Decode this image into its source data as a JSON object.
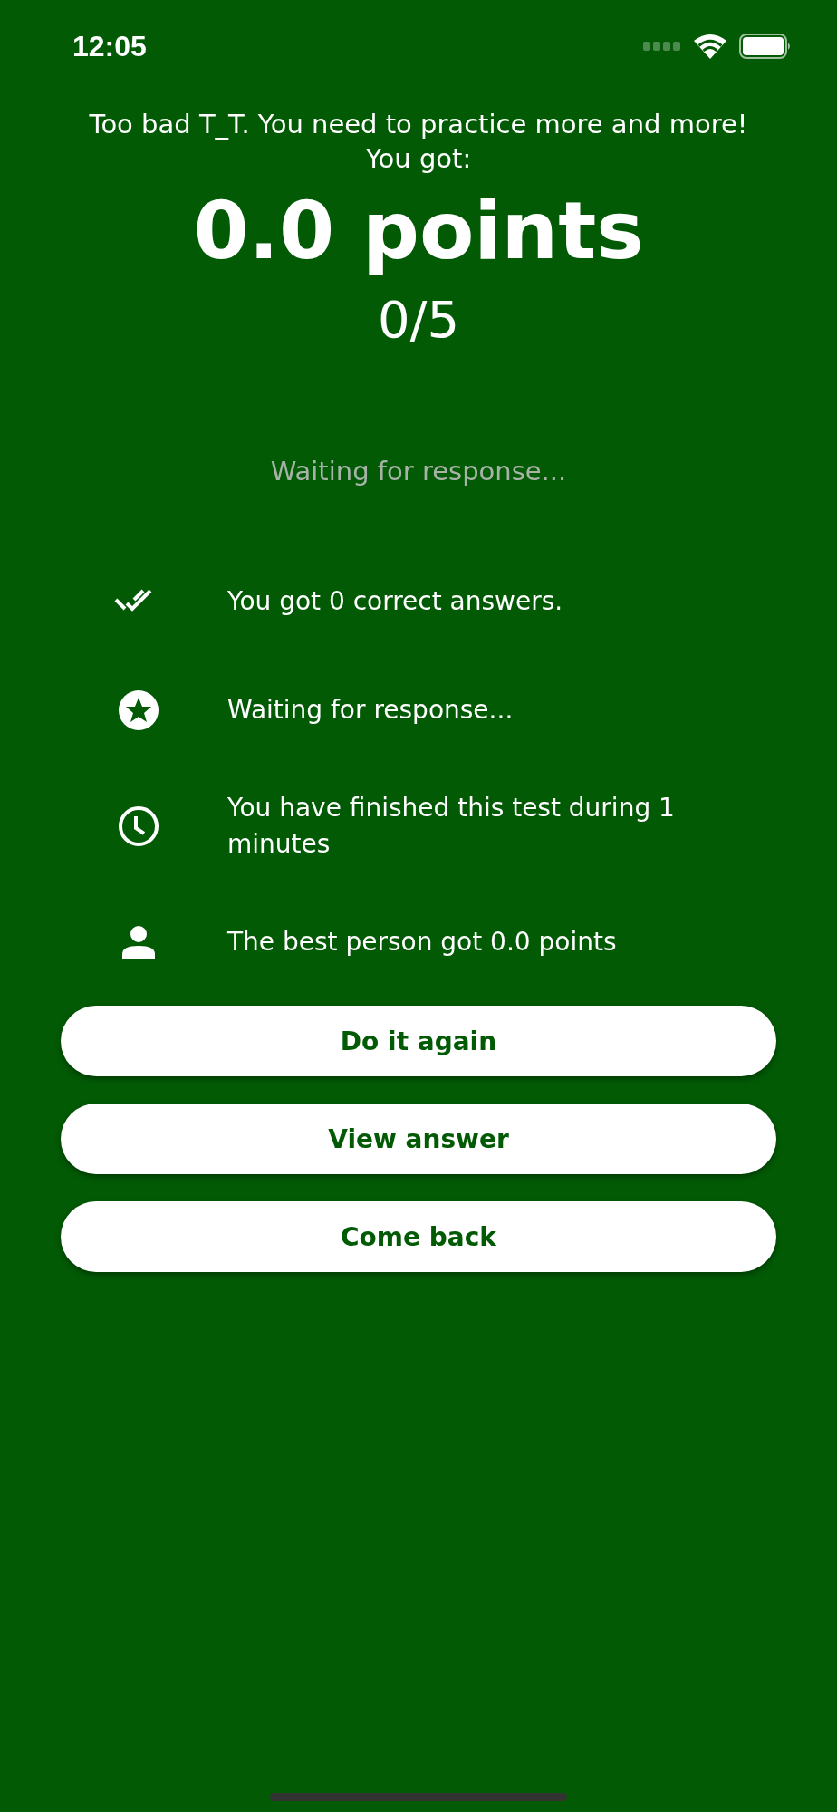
{
  "status_bar": {
    "time": "12:05"
  },
  "message": "Too bad T_T. You need to practice more and more! You got:",
  "score": "0.0 points",
  "fraction": "0/5",
  "rank_status": "Waiting for response...",
  "stats": [
    {
      "text": "You got 0 correct answers."
    },
    {
      "text": "Waiting for response..."
    },
    {
      "text": "You have finished this test during 1 minutes"
    },
    {
      "text": "The best person got 0.0 points"
    }
  ],
  "buttons": [
    {
      "label": "Do it again"
    },
    {
      "label": "View answer"
    },
    {
      "label": "Come back"
    }
  ]
}
